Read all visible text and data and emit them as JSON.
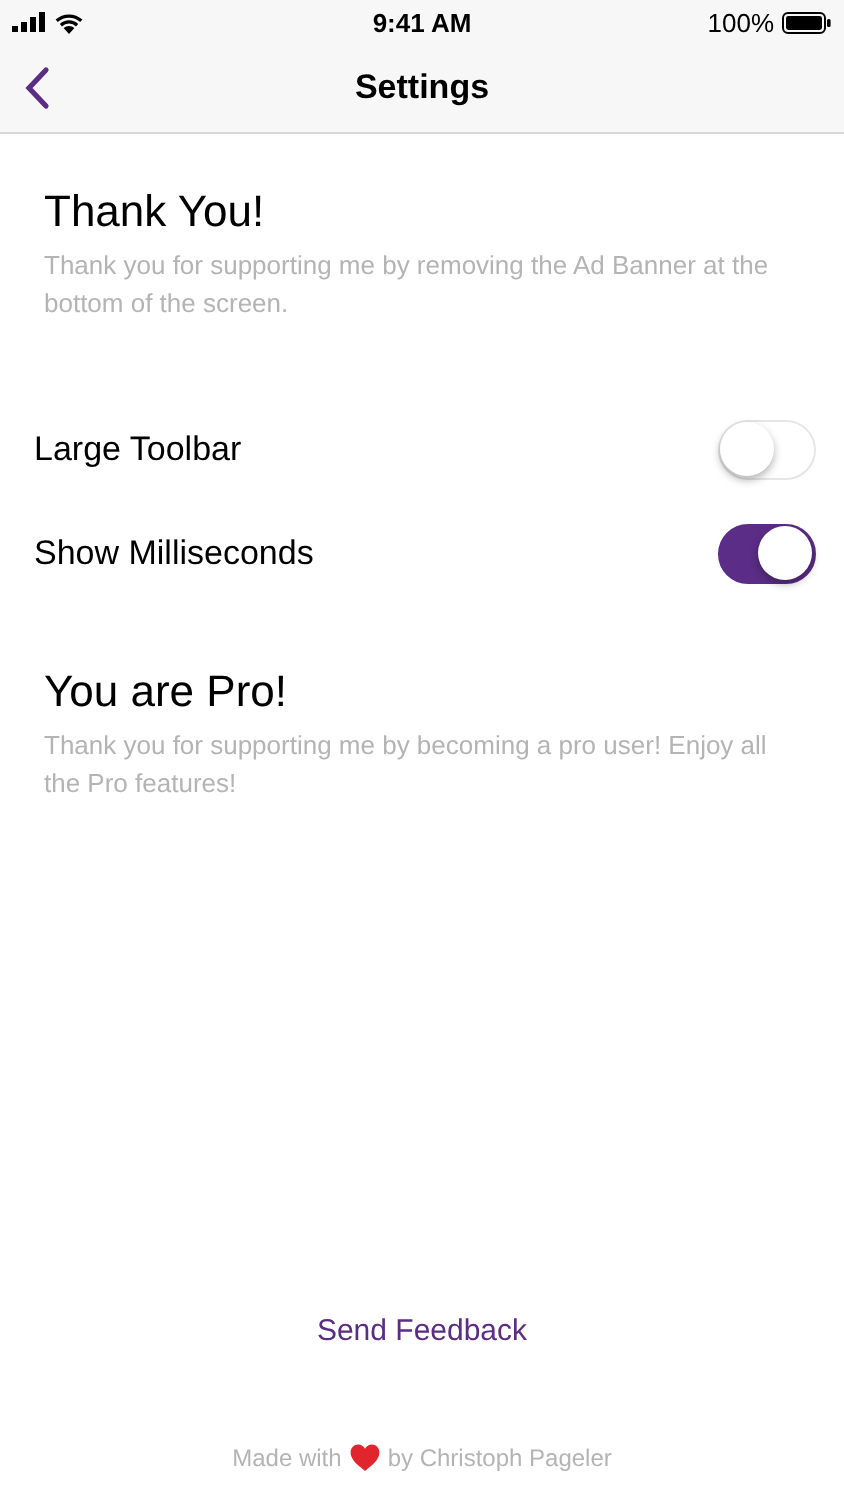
{
  "status_bar": {
    "time": "9:41 AM",
    "battery": "100%"
  },
  "nav": {
    "title": "Settings"
  },
  "sections": [
    {
      "title": "Thank You!",
      "description": "Thank you for supporting me by removing the Ad Banner at the bottom of the screen."
    }
  ],
  "toggles": [
    {
      "label": "Large Toolbar",
      "on": false
    },
    {
      "label": "Show Milliseconds",
      "on": true
    }
  ],
  "pro": {
    "title": "You are Pro!",
    "description": "Thank you for supporting me by becoming a pro user! Enjoy all the Pro features!"
  },
  "feedback_link": "Send Feedback",
  "footer": {
    "before": "Made with",
    "after": "by Christoph Pageler"
  }
}
